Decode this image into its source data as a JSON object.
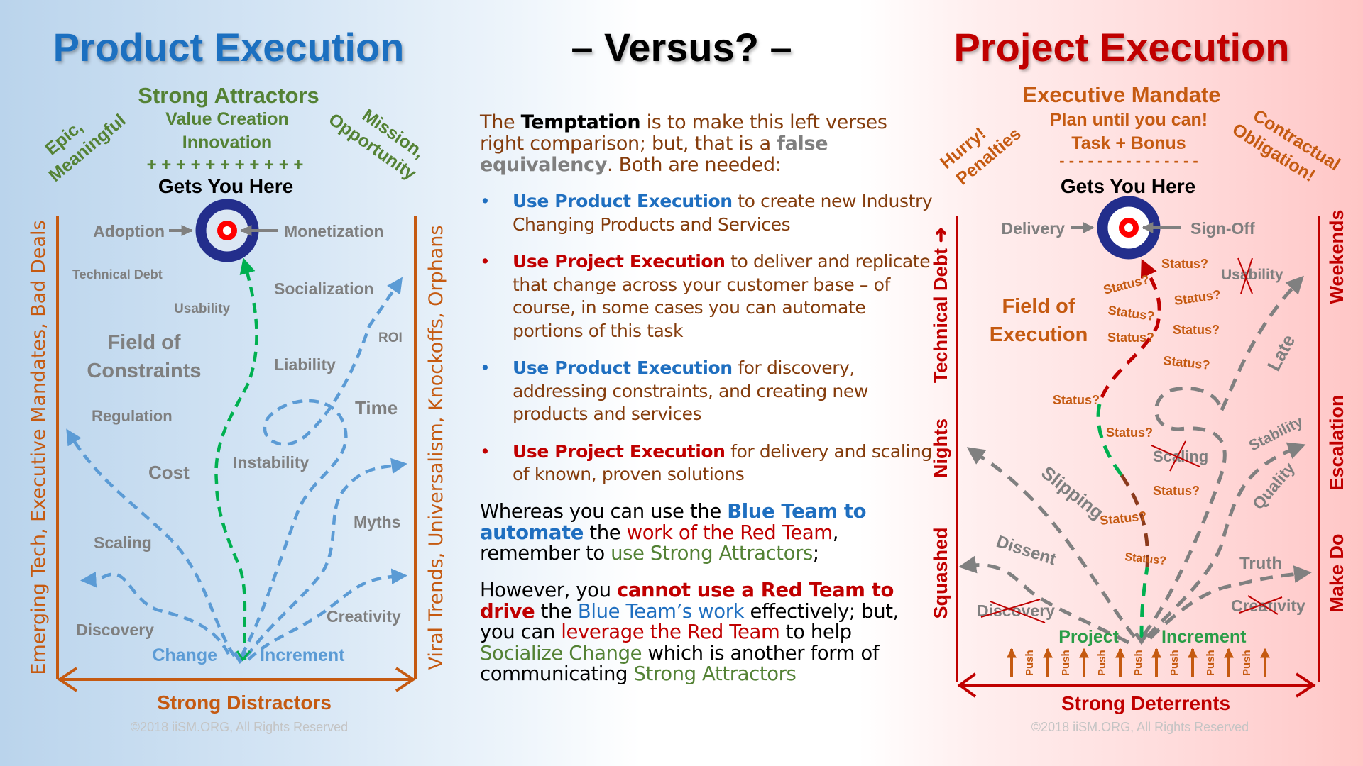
{
  "colors": {
    "blue": "#1f6fc0",
    "red": "#c00000",
    "green": "#548235",
    "orange": "#c55a11",
    "brown": "#843c0c",
    "grey": "#7f7f7f",
    "navy": "#232e8c",
    "dash_blue": "#5b9bd5",
    "dash_green": "#00b050",
    "dash_grey": "#808080"
  },
  "product": {
    "title": "Product Execution",
    "attractors_heading": "Strong Attractors",
    "attractor_lines": [
      "Value Creation",
      "Innovation"
    ],
    "plus_row": "+ + + + + + + + + + +",
    "left_diag": [
      "Epic,",
      "Meaningful"
    ],
    "right_diag": [
      "Mission,",
      "Opportunity"
    ],
    "gets_you_here": "Gets You Here",
    "target_left": "Adoption",
    "target_right": "Monetization",
    "field": [
      "Field of",
      "Constraints"
    ],
    "constraints": [
      "Technical Debt",
      "Usability",
      "Socialization",
      "ROI",
      "Liability",
      "Time",
      "Regulation",
      "Cost",
      "Instability",
      "Myths",
      "Scaling",
      "Creativity",
      "Discovery"
    ],
    "origin_left": "Change",
    "origin_right": "Increment",
    "left_axis": "Emerging Tech,  Executive Mandates,  Bad Deals",
    "right_axis": "Viral Trends,  Universalism,  Knockoffs,  Orphans",
    "bottom_axis": "Strong Distractors",
    "copyright": "©2018 iiSM.ORG, All Rights Reserved"
  },
  "center": {
    "title": "– Versus? –",
    "intro_pre": "The ",
    "intro_bold": "Temptation",
    "intro_mid": " is to make this left verses right comparison; but, that is a ",
    "intro_grey": "false equivalency",
    "intro_post": ".  Both are needed:",
    "bullets": [
      {
        "lead": "Use Product Execution",
        "rest": "  to create new Industry Changing Products and Services"
      },
      {
        "lead": "Use Project Execution",
        "rest": " to deliver and replicate that change across your customer base – of course, in some cases you can automate portions of this task"
      },
      {
        "lead": "Use Product Execution",
        "rest": " for discovery, addressing constraints, and creating new products and services"
      },
      {
        "lead": "Use Project Execution",
        "rest": " for delivery and scaling of known, proven solutions"
      }
    ],
    "para1": {
      "a": "Whereas you can use the ",
      "b": "Blue Team to automate",
      "c": " the ",
      "d": "work of the Red Team",
      "e": ", remember to ",
      "f": "use Strong Attractors",
      "g": ";"
    },
    "para2": {
      "a": "However, you ",
      "b": "cannot use a Red Team to drive",
      "c": " the ",
      "d": "Blue Team’s work",
      "e": " effectively; but, you can ",
      "f": "leverage the Red Team",
      "g": " to help ",
      "h": "Socialize Change",
      "i": " which is another form of communicating ",
      "j": "Strong Attractors"
    }
  },
  "project": {
    "title": "Project Execution",
    "mandate_heading": "Executive Mandate",
    "mandate_lines": [
      "Plan until you can!",
      "Task + Bonus"
    ],
    "dash_row": "- - - - - - - - - - - - - - -",
    "left_diag": [
      "Hurry!",
      "Penalties"
    ],
    "right_diag": [
      "Contractual",
      "Obligation!"
    ],
    "gets_you_here": "Gets You Here",
    "target_left": "Delivery",
    "target_right": "Sign-Off",
    "field": [
      "Field of",
      "Execution"
    ],
    "status_label": "Status?",
    "crossed": [
      "Usability",
      "Scaling",
      "Discovery",
      "Creativity"
    ],
    "paths": [
      "Late",
      "Slipping",
      "Stability",
      "Quality",
      "Dissent",
      "Truth"
    ],
    "origin_left": "Project",
    "origin_right": "Increment",
    "push_label": "Push",
    "push_count": 7,
    "left_axis": [
      "Squashed",
      "Nights",
      "Technical Debt ➜"
    ],
    "right_axis": [
      "Make Do",
      "Escalation",
      "Weekends"
    ],
    "bottom_axis": "Strong Deterrents",
    "copyright": "©2018 iiSM.ORG, All Rights Reserved"
  }
}
